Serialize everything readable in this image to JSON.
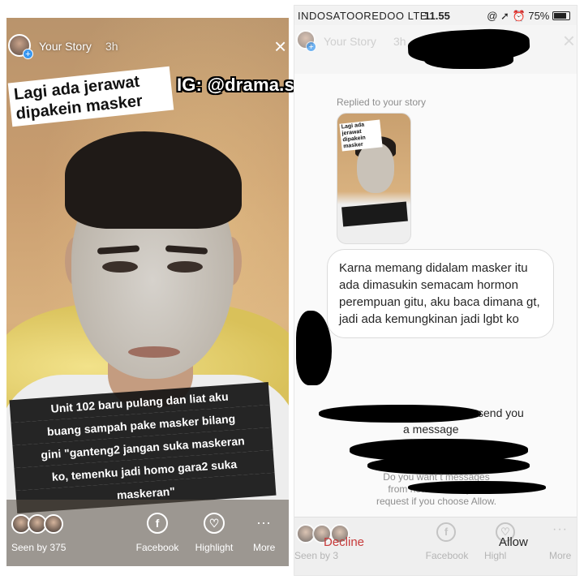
{
  "watermark": "IG: @drama.sosialmedia",
  "left_story": {
    "story_label": "Your Story",
    "time": "3h",
    "caption_top": "Lagi ada jerawat dipakein masker",
    "caption_bottom_lines": [
      "Unit 102 baru pulang dan liat aku",
      "buang sampah pake masker bilang",
      "gini \"ganteng2 jangan suka maskeran",
      "ko, temenku jadi homo gara2 suka",
      "maskeran\""
    ],
    "footer": {
      "seen_by": "Seen by 375",
      "facebook": "Facebook",
      "highlight": "Highlight",
      "more": "More",
      "more_glyph": "···",
      "facebook_glyph": "f",
      "highlight_glyph": "♡"
    }
  },
  "right_dm": {
    "status_bar": {
      "carrier": "INDOSATOOREDOO  LTE",
      "time": "11.55",
      "icons": "@ ➚ ⏰",
      "battery": "75%"
    },
    "story_label": "Your Story",
    "time": "3h",
    "replied_label": "Replied to your story",
    "thumb_caption": "Lagi ada jerawat dipakein masker",
    "message": "Karna memang didalam masker itu ada dimasukin semacam hormon perempuan gitu, aku baca dimana gt, jadi ada kemungkinan jadi lgbt ko",
    "request_line1": "send you",
    "request_line2": "a message",
    "info_lines": [
      "Do you want t              messages",
      "from now on? They              eir",
      "request if you choose Allow."
    ],
    "footer": {
      "seen_by": "Seen by 3",
      "facebook": "Facebook",
      "highlight": "Highl",
      "more": "More",
      "decline": "Decline",
      "allow": "Allow",
      "facebook_glyph": "f",
      "highlight_glyph": "♡",
      "more_glyph": "···"
    }
  }
}
